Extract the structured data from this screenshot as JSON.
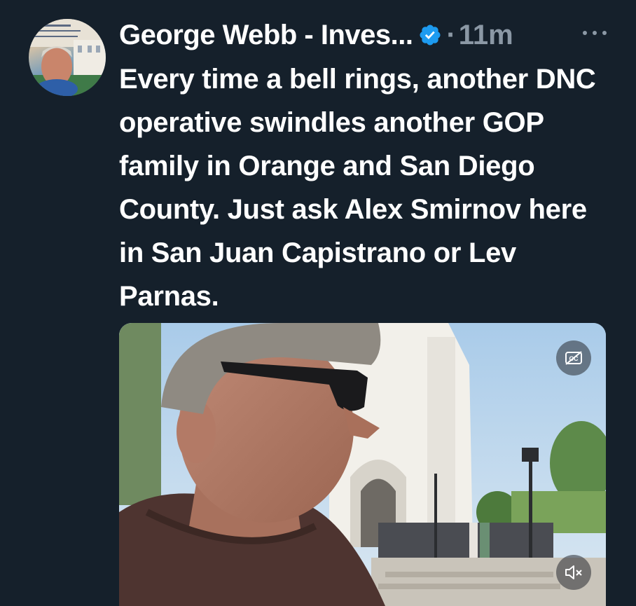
{
  "tweet": {
    "author_name": "George Webb - Inves...",
    "separator": "·",
    "time": "11m",
    "text": "Every time a bell rings, another DNC operative swindles another GOP family in Orange and San Diego County. Just ask Alex Smirnov here in San Juan Capistrano or Lev Parnas.",
    "verified_color": "#1d9bf0",
    "icons": {
      "verified": "verified-badge-icon",
      "more": "more-options-icon",
      "captions": "closed-captions-icon",
      "mute": "muted-speaker-icon"
    }
  },
  "colors": {
    "background": "#15202b",
    "text_primary": "#ffffff",
    "text_secondary": "#8b98a5"
  }
}
